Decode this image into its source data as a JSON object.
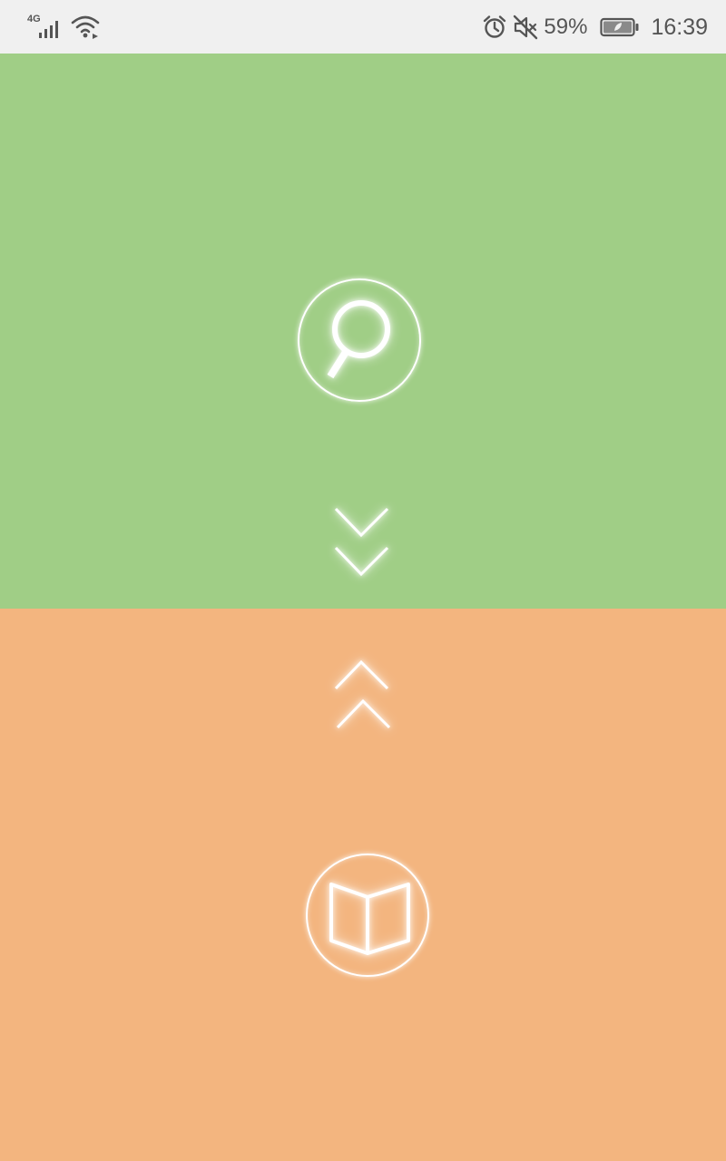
{
  "status_bar": {
    "network_type": "4G",
    "battery_percent": "59%",
    "time": "16:39",
    "icons": [
      "signal-icon",
      "wifi-icon",
      "alarm-icon",
      "mute-icon",
      "battery-icon"
    ]
  },
  "colors": {
    "status_bar_bg": "#f0f0f0",
    "top_panel": "#a0ce86",
    "bottom_panel": "#f3b57f",
    "foreground": "#ffffff"
  },
  "top_panel": {
    "icon": "search-icon",
    "hint_icon": "chevron-double-down-icon"
  },
  "bottom_panel": {
    "icon": "book-open-icon",
    "hint_icon": "chevron-double-up-icon"
  }
}
